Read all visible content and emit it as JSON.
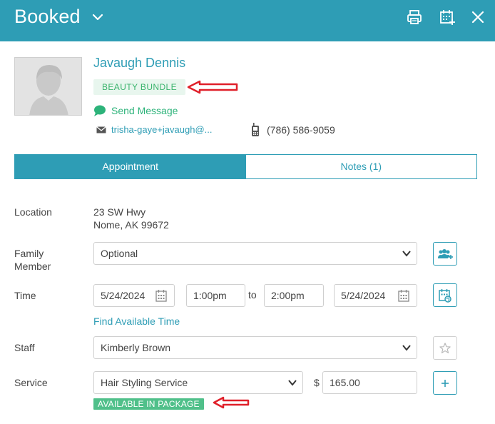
{
  "header": {
    "title": "Booked",
    "icons": [
      "chevron-down-icon",
      "print-icon",
      "calendar-add-icon",
      "close-icon"
    ]
  },
  "client": {
    "name": "Javaugh Dennis",
    "badge": "BEAUTY BUNDLE",
    "send_message": "Send Message",
    "email": "trisha-gaye+javaugh@...",
    "phone": "(786) 586-9059"
  },
  "tabs": [
    {
      "label": "Appointment",
      "active": true
    },
    {
      "label": "Notes (1)",
      "active": false
    }
  ],
  "form": {
    "location_label": "Location",
    "location_line1": "23 SW Hwy",
    "location_line2": "Nome, AK 99672",
    "family_label_1": "Family",
    "family_label_2": "Member",
    "family_value": "Optional",
    "time_label": "Time",
    "start_date": "5/24/2024",
    "start_time": "1:00pm",
    "to_label": "to",
    "end_time": "2:00pm",
    "end_date": "5/24/2024",
    "find_time": "Find Available Time",
    "staff_label": "Staff",
    "staff_value": "Kimberly Brown",
    "service_label": "Service",
    "service_value": "Hair Styling Service",
    "currency": "$",
    "price": "165.00",
    "package_badge": "AVAILABLE IN PACKAGE"
  },
  "colors": {
    "header_bg": "#2e9db5",
    "accent": "#2e9db5",
    "green": "#3cb46e",
    "badge_bg": "#e8f6ee",
    "package_bg": "#50c08a",
    "annotation_arrow": "#e0202a"
  }
}
